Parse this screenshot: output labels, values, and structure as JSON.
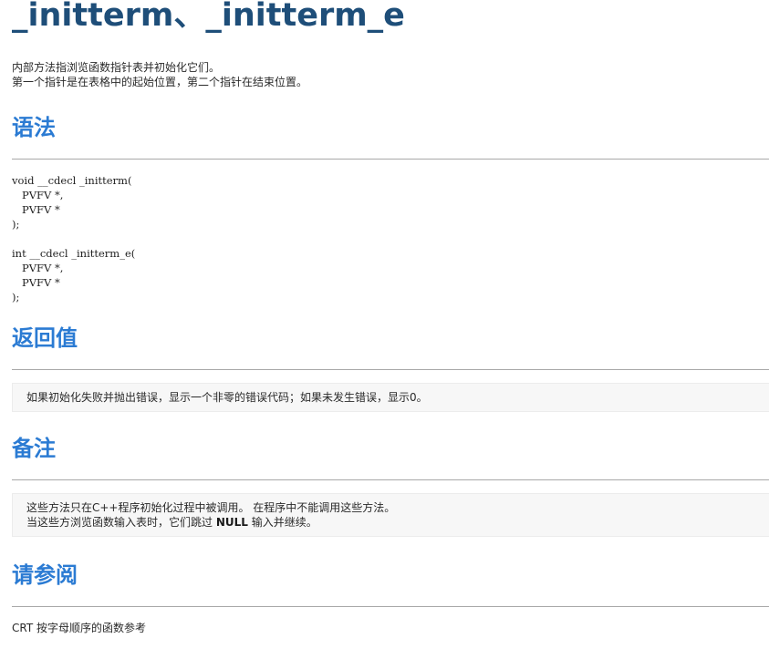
{
  "title": "_initterm、_initterm_e",
  "intro": {
    "line1": "内部方法指浏览函数指针表并初始化它们。",
    "line2": "第一个指针是在表格中的起始位置，第二个指针在结束位置。"
  },
  "syntax": {
    "heading": "语法",
    "code": "void __cdecl _initterm(\n   PVFV *,\n   PVFV *\n);\n\nint __cdecl _initterm_e(\n   PVFV *,\n   PVFV *\n);"
  },
  "return_value": {
    "heading": "返回值",
    "text": "如果初始化失败并抛出错误，显示一个非零的错误代码；如果未发生错误，显示0。"
  },
  "remarks": {
    "heading": "备注",
    "line1": "这些方法只在C++程序初始化过程中被调用。 在程序中不能调用这些方法。",
    "line2_before": "当这些方浏览函数输入表时，它们跳过 ",
    "line2_bold": "NULL",
    "line2_after": " 输入并继续。"
  },
  "see_also": {
    "heading": "请参阅",
    "link": "CRT 按字母顺序的函数参考"
  },
  "colors": {
    "title": "#1e4e79",
    "heading": "#2b7bd3",
    "note_background": "#f7f7f7",
    "rule": "#a8a8a8"
  }
}
